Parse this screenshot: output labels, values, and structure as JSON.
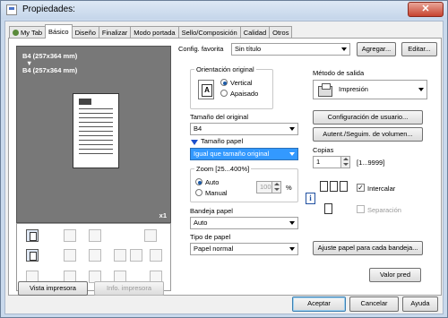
{
  "window": {
    "title": "Propiedades:",
    "close": "✕"
  },
  "tabs": [
    {
      "label": "My Tab"
    },
    {
      "label": "Básico"
    },
    {
      "label": "Diseño"
    },
    {
      "label": "Finalizar"
    },
    {
      "label": "Modo portada"
    },
    {
      "label": "Sello/Composición"
    },
    {
      "label": "Calidad"
    },
    {
      "label": "Otros"
    }
  ],
  "preview": {
    "line1": "B4 (257x364 mm)",
    "arrow": "▼",
    "line2": "B4 (257x364 mm)",
    "count": "x1"
  },
  "left_buttons": {
    "view_printer": "Vista impresora",
    "printer_info": "Info. impresora"
  },
  "favorite": {
    "label": "Config. favorita",
    "value": "Sin título",
    "add": "Agregar...",
    "edit": "Editar..."
  },
  "orientation": {
    "title": "Orientación original",
    "vertical": "Vertical",
    "landscape": "Apaisado"
  },
  "original_size": {
    "label": "Tamaño del original",
    "value": "B4"
  },
  "paper_size": {
    "label": "Tamaño papel",
    "value": "Igual que tamaño original"
  },
  "zoom": {
    "title": "Zoom [25...400%]",
    "auto": "Auto",
    "manual": "Manual",
    "value": "100",
    "unit": "%"
  },
  "tray": {
    "label": "Bandeja papel",
    "value": "Auto"
  },
  "paper_type": {
    "label": "Tipo de papel",
    "value": "Papel normal"
  },
  "output": {
    "label": "Método de salida",
    "value": "Impresión",
    "user_settings": "Configuración de usuario...",
    "auth_tracking": "Autent./Seguim. de volumen..."
  },
  "copies": {
    "label": "Copias",
    "value": "1",
    "range": "[1...9999]",
    "collate": "Intercalar",
    "collate_check": "✓",
    "separation": "Separación"
  },
  "adjust_paper": "Ajuste papel para cada bandeja...",
  "default_button": "Valor pred",
  "bottom": {
    "ok": "Aceptar",
    "cancel": "Cancelar",
    "help": "Ayuda"
  },
  "icons": {
    "info": "i"
  }
}
